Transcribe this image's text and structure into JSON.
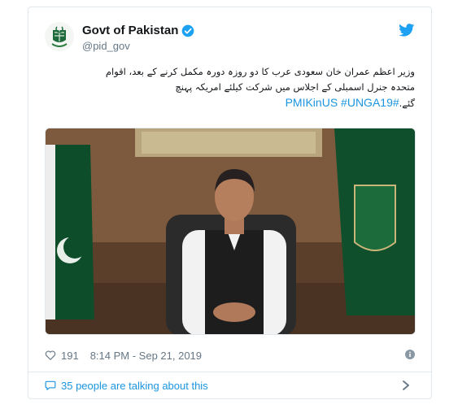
{
  "tweet": {
    "display_name": "Govt of Pakistan",
    "handle": "@pid_gov",
    "text_lines": [
      "وزیر اعظم عمران خان سعودی عرب کا دو روزہ دورہ مکمل کرنے کے بعد، اقوام",
      "متحدہ جنرل اسمبلی کے اجلاس میں شرکت کیلئے امریکہ پہنچ",
      "گئے."
    ],
    "hashtags": [
      "#PMIKinUS",
      "#UNGA19"
    ],
    "likes": "191",
    "timestamp": "8:14 PM - Sep 21, 2019",
    "conversation": "35 people are talking about this"
  },
  "icons": {
    "verified": "verified-badge-icon",
    "twitter": "twitter-bird-icon",
    "like": "heart-icon",
    "info": "info-icon",
    "reply": "speech-bubble-icon",
    "chevron": "chevron-right-icon"
  },
  "colors": {
    "link": "#1b95e0",
    "muted": "#657786",
    "text": "#14171a",
    "border": "#e1e8ed"
  }
}
